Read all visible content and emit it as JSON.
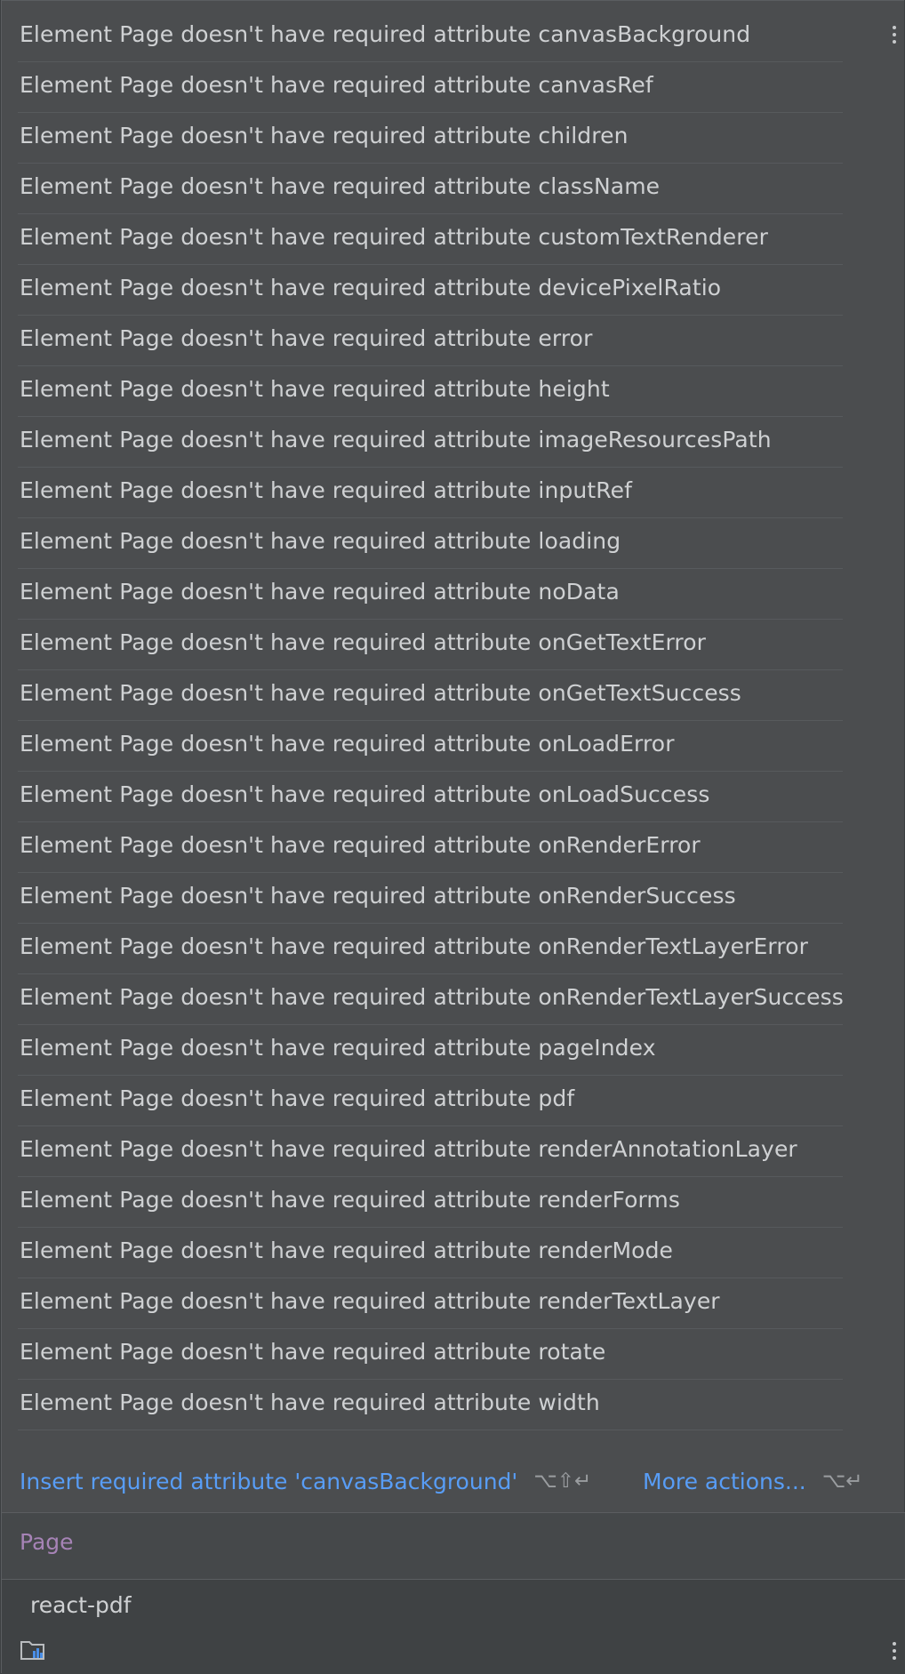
{
  "problems": [
    "Element Page doesn't have required attribute canvasBackground",
    "Element Page doesn't have required attribute canvasRef",
    "Element Page doesn't have required attribute children",
    "Element Page doesn't have required attribute className",
    "Element Page doesn't have required attribute customTextRenderer",
    "Element Page doesn't have required attribute devicePixelRatio",
    "Element Page doesn't have required attribute error",
    "Element Page doesn't have required attribute height",
    "Element Page doesn't have required attribute imageResourcesPath",
    "Element Page doesn't have required attribute inputRef",
    "Element Page doesn't have required attribute loading",
    "Element Page doesn't have required attribute noData",
    "Element Page doesn't have required attribute onGetTextError",
    "Element Page doesn't have required attribute onGetTextSuccess",
    "Element Page doesn't have required attribute onLoadError",
    "Element Page doesn't have required attribute onLoadSuccess",
    "Element Page doesn't have required attribute onRenderError",
    "Element Page doesn't have required attribute onRenderSuccess",
    "Element Page doesn't have required attribute onRenderTextLayerError",
    "Element Page doesn't have required attribute onRenderTextLayerSuccess",
    "Element Page doesn't have required attribute pageIndex",
    "Element Page doesn't have required attribute pdf",
    "Element Page doesn't have required attribute renderAnnotationLayer",
    "Element Page doesn't have required attribute renderForms",
    "Element Page doesn't have required attribute renderMode",
    "Element Page doesn't have required attribute renderTextLayer",
    "Element Page doesn't have required attribute rotate",
    "Element Page doesn't have required attribute width"
  ],
  "actions": {
    "insert_label": "Insert required attribute 'canvasBackground'",
    "insert_shortcut": "⌥⇧↵",
    "more_label": "More actions...",
    "more_shortcut": "⌥↵"
  },
  "documentation": {
    "title": "Page",
    "module": "react-pdf"
  },
  "icons": {
    "top_menu": "kebab-menu-icon",
    "bottom_menu": "kebab-menu-icon",
    "module": "folder-library-icon"
  },
  "colors": {
    "link": "#589df6",
    "doc_title": "#a683b6",
    "background": "#4b4d4f"
  }
}
